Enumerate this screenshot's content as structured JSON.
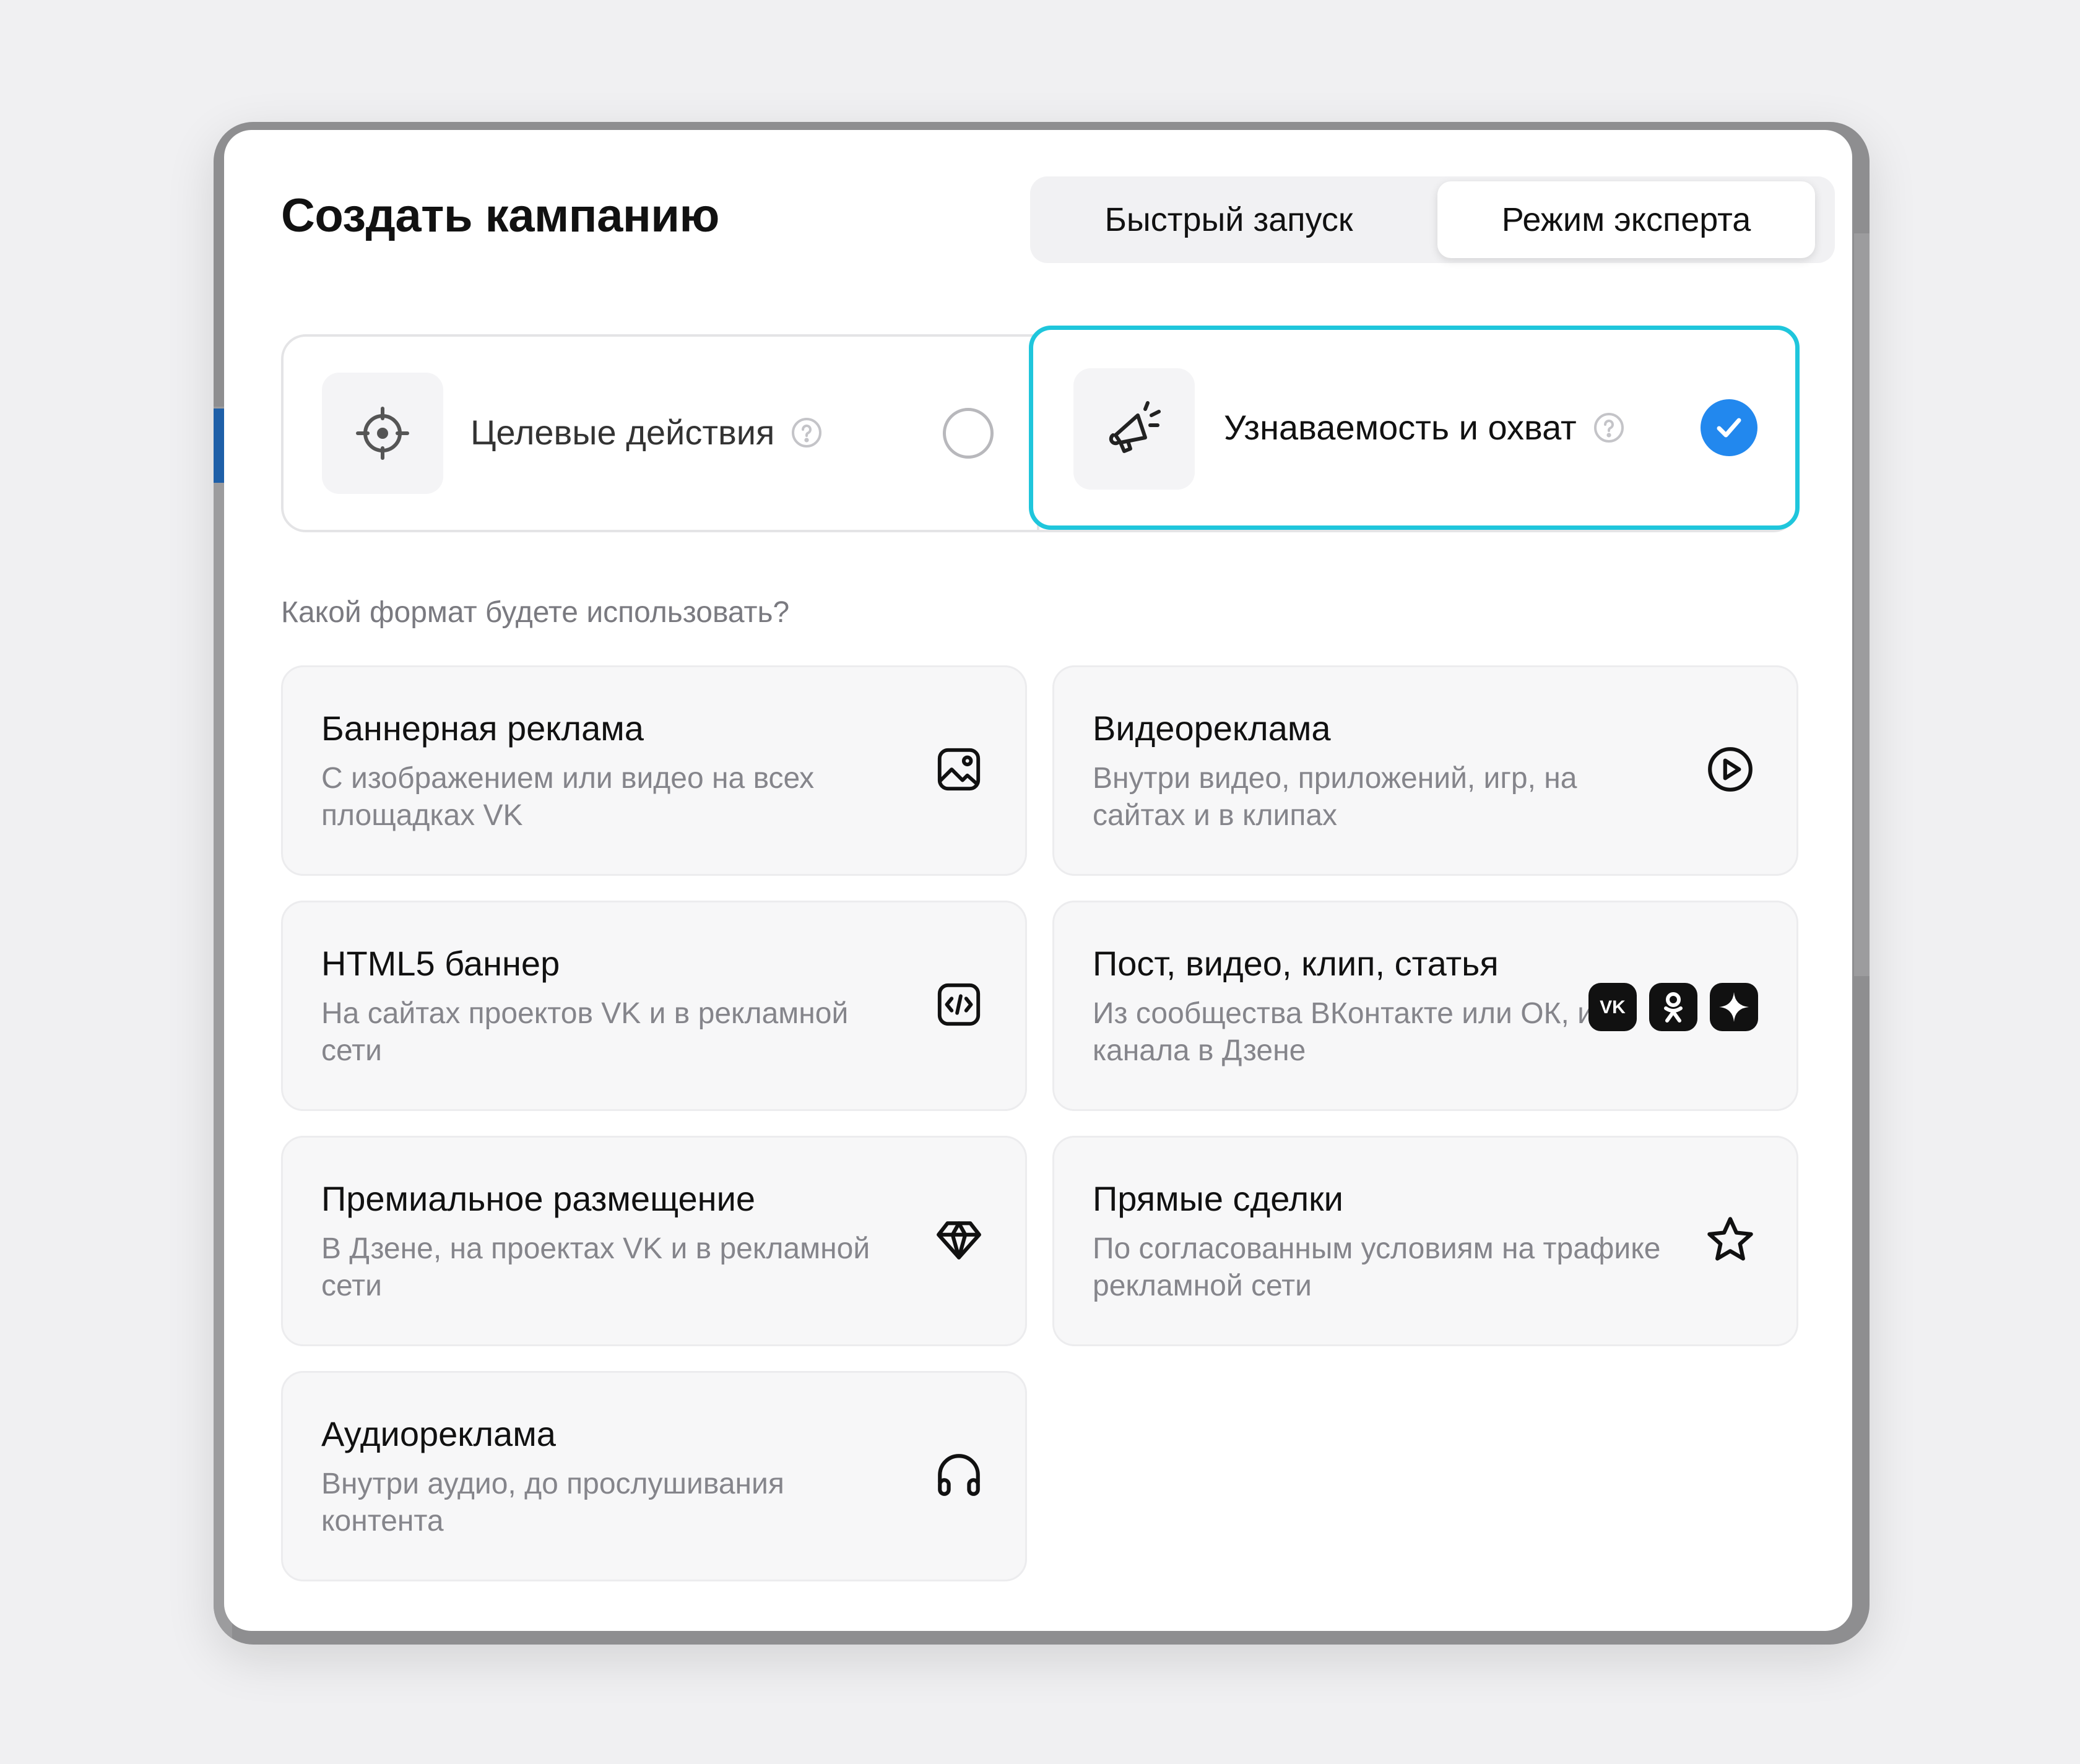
{
  "modal": {
    "title": "Создать кампанию",
    "mode_switch": {
      "quick": "Быстрый запуск",
      "expert": "Режим эксперта",
      "selected": "expert"
    }
  },
  "goals": [
    {
      "label": "Целевые действия",
      "icon": "target-icon",
      "selected": false
    },
    {
      "label": "Узнаваемость и охват",
      "icon": "megaphone-icon",
      "selected": true
    }
  ],
  "formats_question": "Какой формат будете использовать?",
  "formats": [
    {
      "title": "Баннерная реклама",
      "desc": "С изображением или видео на всех площадках VK",
      "icon": "image-icon"
    },
    {
      "title": "Видеореклама",
      "desc": "Внутри видео, приложений, игр, на сайтах и в клипах",
      "icon": "play-circle-icon"
    },
    {
      "title": "HTML5 баннер",
      "desc": "На сайтах проектов VK и в рекламной сети",
      "icon": "code-icon"
    },
    {
      "title": "Пост, видео, клип, статья",
      "desc": "Из сообщества ВКонтакте или ОК, из канала в Дзене",
      "icon": "platform-icons"
    },
    {
      "title": "Премиальное размещение",
      "desc": "В Дзене, на проектах VK и в рекламной сети",
      "icon": "diamond-icon"
    },
    {
      "title": "Прямые сделки",
      "desc": "По согласованным условиям на трафике рекламной сети",
      "icon": "star-icon"
    },
    {
      "title": "Аудиореклама",
      "desc": "Внутри аудио, до прослушивания контента",
      "icon": "headphones-icon"
    }
  ],
  "colors": {
    "accent": "#2288ee",
    "focus": "#1fc6dc",
    "text": "#111111",
    "muted": "#85858b"
  }
}
